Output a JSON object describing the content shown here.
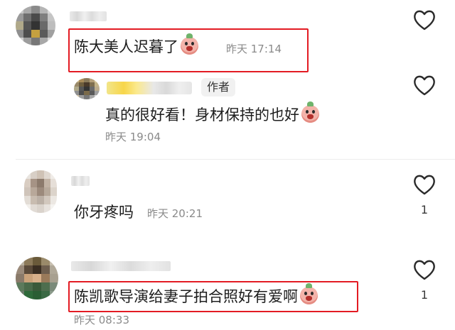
{
  "comments": [
    {
      "text": "陈大美人迟暮了",
      "emoji": "crying-emoji",
      "time": "昨天 17:14",
      "likes": "",
      "reply": {
        "badge": "作者",
        "text": "真的很好看！身材保持的也好",
        "emoji": "crying-emoji",
        "time": "昨天 19:04"
      }
    },
    {
      "text": "你牙疼吗",
      "time": "昨天 20:21",
      "likes": "1"
    },
    {
      "text": "陈凯歌导演给妻子拍合照好有爱啊",
      "emoji": "crying-emoji",
      "time": "昨天 08:33",
      "likes": "1"
    }
  ],
  "colors": {
    "highlight": "#e31b23",
    "time": "#8a8a8a"
  }
}
